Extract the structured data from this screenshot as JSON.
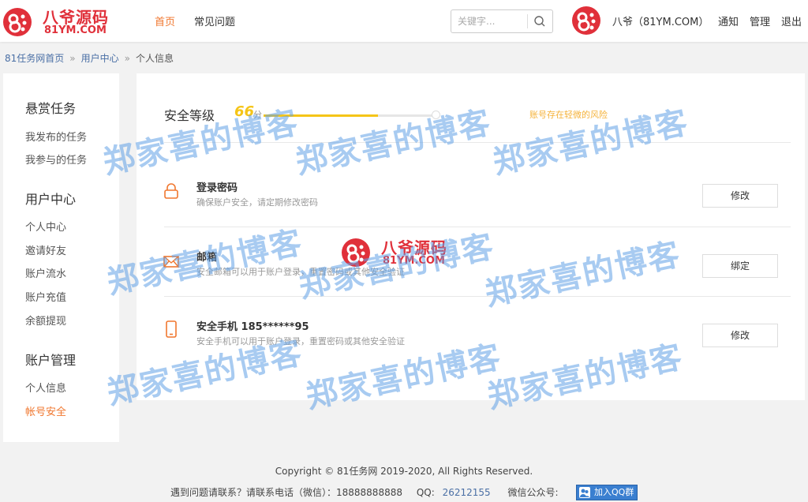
{
  "brand": {
    "name": "八爷源码",
    "domain": "81YM.COM",
    "color": "#e0303a"
  },
  "nav": {
    "home": "首页",
    "faq": "常见问题"
  },
  "search": {
    "placeholder": "关键字..."
  },
  "user": {
    "name": "八爷（81YM.COM）",
    "notify": "通知",
    "admin": "管理",
    "logout": "退出"
  },
  "breadcrumb": {
    "home": "81任务网首页",
    "sep": "»",
    "center": "用户中心",
    "current": "个人信息"
  },
  "sidebar": {
    "groups": [
      {
        "title": "悬赏任务",
        "items": [
          "我发布的任务",
          "我参与的任务"
        ]
      },
      {
        "title": "用户中心",
        "items": [
          "个人中心",
          "邀请好友",
          "账户流水",
          "账户充值",
          "余额提现"
        ]
      },
      {
        "title": "账户管理",
        "items": [
          "个人信息",
          "帐号安全"
        ]
      }
    ],
    "active_item": "帐号安全",
    "active_color": "#f0772f"
  },
  "security": {
    "title": "安全等级",
    "score": "66",
    "unit": "分",
    "progress": 0.66,
    "risk": "账号存在轻微的风险",
    "rows": [
      {
        "icon": "lock-icon",
        "title": "登录密码",
        "desc": "确保账户安全，请定期修改密码",
        "button": "修改"
      },
      {
        "icon": "mail-icon",
        "title": "邮箱",
        "desc": "安全邮箱可以用于账户登录，重置密码或其他安全验证",
        "button": "绑定"
      },
      {
        "icon": "phone-icon",
        "title": "安全手机 185******95",
        "desc": "安全手机可以用于账户登录，重置密码或其他安全验证",
        "button": "修改"
      }
    ]
  },
  "watermark": "郑家喜的博客",
  "footer": {
    "copyright": "Copyright © 81任务网 2019-2020, All Rights Reserved.",
    "contact": "遇到问题请联系？请联系电话（微信）：18888888888",
    "qq_label": "QQ:",
    "qq_number": "26212155",
    "wechat": "微信公众号:",
    "qq_group": "加入QQ群"
  }
}
